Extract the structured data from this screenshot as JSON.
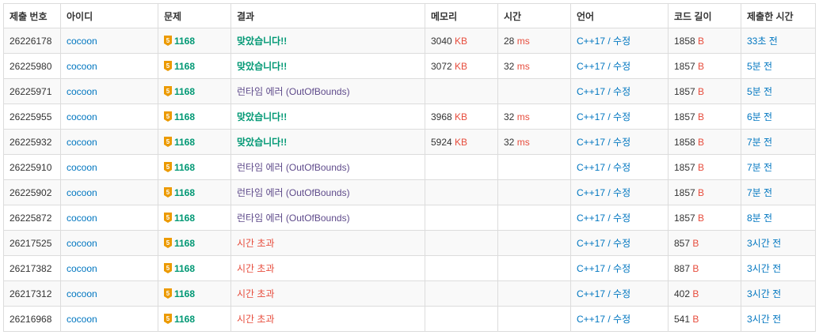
{
  "columns": [
    "제출 번호",
    "아이디",
    "문제",
    "결과",
    "메모리",
    "시간",
    "언어",
    "코드 길이",
    "제출한 시간"
  ],
  "colors": {
    "accepted": "#009874",
    "runtime_error": "#5f4b8b",
    "time_limit": "#e74c3c",
    "link": "#0076c0",
    "unit": "#e74c3c",
    "tier_gold": "#ec9a00"
  },
  "units": {
    "memory": "KB",
    "time": "ms",
    "code": "B"
  },
  "lang_edit": "수정",
  "rows": [
    {
      "id": "26226178",
      "user": "cocoon",
      "problem": "1168",
      "result": "맞았습니다!!",
      "status": "ac",
      "memory": "3040",
      "time": "28",
      "lang": "C++17",
      "length": "1858",
      "submitted": "33초 전"
    },
    {
      "id": "26225980",
      "user": "cocoon",
      "problem": "1168",
      "result": "맞았습니다!!",
      "status": "ac",
      "memory": "3072",
      "time": "32",
      "lang": "C++17",
      "length": "1857",
      "submitted": "5분 전"
    },
    {
      "id": "26225971",
      "user": "cocoon",
      "problem": "1168",
      "result": "런타임 에러 (OutOfBounds)",
      "status": "rte",
      "memory": "",
      "time": "",
      "lang": "C++17",
      "length": "1857",
      "submitted": "5분 전"
    },
    {
      "id": "26225955",
      "user": "cocoon",
      "problem": "1168",
      "result": "맞았습니다!!",
      "status": "ac",
      "memory": "3968",
      "time": "32",
      "lang": "C++17",
      "length": "1857",
      "submitted": "6분 전"
    },
    {
      "id": "26225932",
      "user": "cocoon",
      "problem": "1168",
      "result": "맞았습니다!!",
      "status": "ac",
      "memory": "5924",
      "time": "32",
      "lang": "C++17",
      "length": "1858",
      "submitted": "7분 전"
    },
    {
      "id": "26225910",
      "user": "cocoon",
      "problem": "1168",
      "result": "런타임 에러 (OutOfBounds)",
      "status": "rte",
      "memory": "",
      "time": "",
      "lang": "C++17",
      "length": "1857",
      "submitted": "7분 전"
    },
    {
      "id": "26225902",
      "user": "cocoon",
      "problem": "1168",
      "result": "런타임 에러 (OutOfBounds)",
      "status": "rte",
      "memory": "",
      "time": "",
      "lang": "C++17",
      "length": "1857",
      "submitted": "7분 전"
    },
    {
      "id": "26225872",
      "user": "cocoon",
      "problem": "1168",
      "result": "런타임 에러 (OutOfBounds)",
      "status": "rte",
      "memory": "",
      "time": "",
      "lang": "C++17",
      "length": "1857",
      "submitted": "8분 전"
    },
    {
      "id": "26217525",
      "user": "cocoon",
      "problem": "1168",
      "result": "시간 초과",
      "status": "tle",
      "memory": "",
      "time": "",
      "lang": "C++17",
      "length": "857",
      "submitted": "3시간 전"
    },
    {
      "id": "26217382",
      "user": "cocoon",
      "problem": "1168",
      "result": "시간 초과",
      "status": "tle",
      "memory": "",
      "time": "",
      "lang": "C++17",
      "length": "887",
      "submitted": "3시간 전"
    },
    {
      "id": "26217312",
      "user": "cocoon",
      "problem": "1168",
      "result": "시간 초과",
      "status": "tle",
      "memory": "",
      "time": "",
      "lang": "C++17",
      "length": "402",
      "submitted": "3시간 전"
    },
    {
      "id": "26216968",
      "user": "cocoon",
      "problem": "1168",
      "result": "시간 초과",
      "status": "tle",
      "memory": "",
      "time": "",
      "lang": "C++17",
      "length": "541",
      "submitted": "3시간 전"
    }
  ]
}
